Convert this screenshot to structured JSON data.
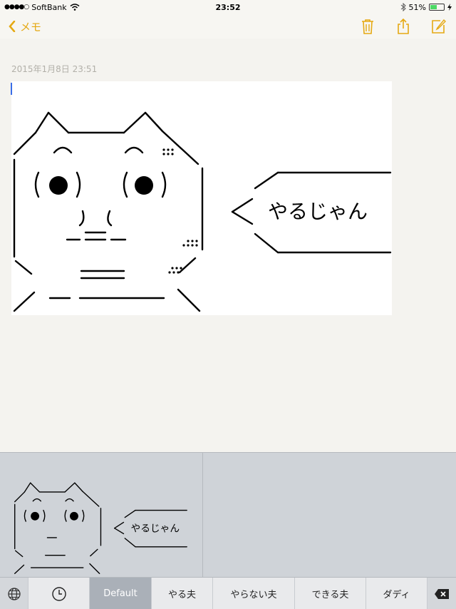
{
  "status": {
    "carrier": "SoftBank",
    "time": "23:52",
    "battery": "51%",
    "battery_level": 0.51
  },
  "nav": {
    "back_label": "メモ"
  },
  "note": {
    "date": "2015年1月8日 23:51",
    "speech_text": "やるじゃん"
  },
  "keyboard": {
    "thumb_text": "やるじゃん",
    "categories": [
      "Default",
      "やる夫",
      "やらない夫",
      "できる夫",
      "ダディ"
    ]
  },
  "colors": {
    "accent": "#e5a913"
  }
}
